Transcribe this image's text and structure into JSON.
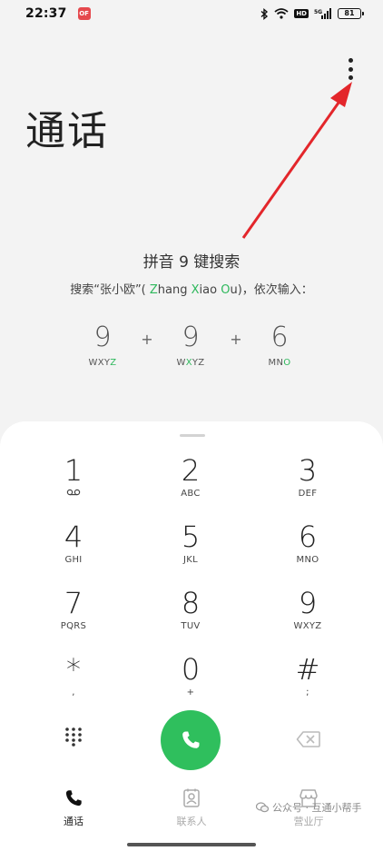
{
  "status_bar": {
    "time": "22:37",
    "app_badge": "OF",
    "hd": "HD",
    "signal_label": "5G",
    "battery": "81"
  },
  "header": {
    "title": "通话",
    "menu_icon": "more-vertical-icon"
  },
  "hint": {
    "title": "拼音 9 键搜索",
    "desc_prefix": "搜索“张小欧”( ",
    "z": "Z",
    "hang": "hang ",
    "x": "X",
    "iao": "iao ",
    "o": "O",
    "u": "u",
    "desc_suffix": ")，依次输入：",
    "keys": [
      {
        "digit": "9",
        "letters_prefix": "WXY",
        "letters_hl": "Z",
        "letters_suffix": ""
      },
      {
        "digit": "9",
        "letters_prefix": "W",
        "letters_hl": "X",
        "letters_suffix": "YZ"
      },
      {
        "digit": "6",
        "letters_prefix": "MN",
        "letters_hl": "O",
        "letters_suffix": ""
      }
    ],
    "plus": "+"
  },
  "dialpad": {
    "keys": [
      {
        "digit": "1",
        "sub": ""
      },
      {
        "digit": "2",
        "sub": "ABC"
      },
      {
        "digit": "3",
        "sub": "DEF"
      },
      {
        "digit": "4",
        "sub": "GHI"
      },
      {
        "digit": "5",
        "sub": "JKL"
      },
      {
        "digit": "6",
        "sub": "MNO"
      },
      {
        "digit": "7",
        "sub": "PQRS"
      },
      {
        "digit": "8",
        "sub": "TUV"
      },
      {
        "digit": "9",
        "sub": "WXYZ"
      },
      {
        "digit": "*",
        "sub": ","
      },
      {
        "digit": "0",
        "sub": "+"
      },
      {
        "digit": "#",
        "sub": ";"
      }
    ],
    "voicemail_icon": "voicemail-icon",
    "call_icon": "phone-icon",
    "grid_icon": "grid-icon",
    "backspace_icon": "backspace-icon"
  },
  "tabs": [
    {
      "label": "通话",
      "icon": "phone-icon",
      "active": true
    },
    {
      "label": "联系人",
      "icon": "contacts-icon",
      "active": false
    },
    {
      "label": "营业厅",
      "icon": "store-icon",
      "active": false
    }
  ],
  "watermark": "公众号 · 互通小帮手",
  "colors": {
    "accent_green": "#2fbf5d",
    "arrow_red": "#e3262b",
    "background": "#f3f3f3"
  }
}
